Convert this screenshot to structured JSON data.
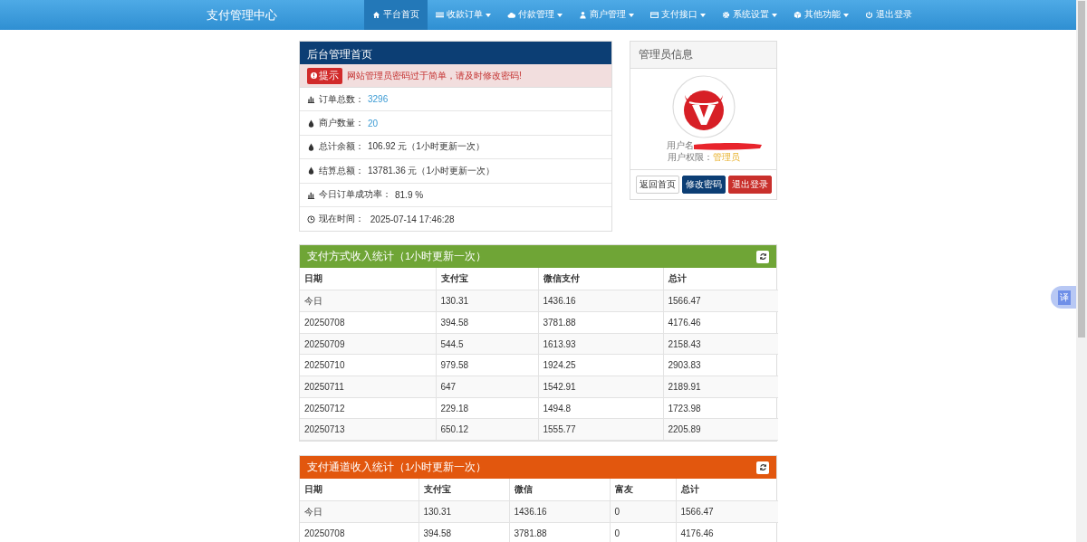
{
  "navbar": {
    "brand": "支付管理中心",
    "items": [
      {
        "label": "平台首页",
        "kind": "home",
        "dropdown": false,
        "selected": true
      },
      {
        "label": "收款订单",
        "kind": "list",
        "dropdown": true,
        "selected": false
      },
      {
        "label": "付款管理",
        "kind": "cloud",
        "dropdown": true,
        "selected": false
      },
      {
        "label": "商户管理",
        "kind": "user",
        "dropdown": true,
        "selected": false
      },
      {
        "label": "支付接口",
        "kind": "card",
        "dropdown": true,
        "selected": false
      },
      {
        "label": "系统设置",
        "kind": "gear",
        "dropdown": true,
        "selected": false
      },
      {
        "label": "其他功能",
        "kind": "cube",
        "dropdown": true,
        "selected": false
      },
      {
        "label": "退出登录",
        "kind": "power",
        "dropdown": false,
        "selected": false
      }
    ]
  },
  "overview": {
    "title": "后台管理首页",
    "alert": {
      "badge": "提示",
      "text": "网站管理员密码过于简单，请及时修改密码!"
    },
    "rows": [
      {
        "kind": "bars",
        "label": "订单总数：",
        "value": "3296",
        "accent": true
      },
      {
        "kind": "drop",
        "label": "商户数量：",
        "value": "20",
        "accent": true
      },
      {
        "kind": "drop",
        "label": "总计余额：",
        "value": "106.92 元（1小时更新一次）",
        "accent": false
      },
      {
        "kind": "drop",
        "label": "结算总额：",
        "value": "13781.36 元（1小时更新一次）",
        "accent": false
      },
      {
        "kind": "bars",
        "label": "今日订单成功率：",
        "value": "81.9 %",
        "accent": false
      },
      {
        "kind": "clock",
        "label": "现在时间：",
        "value": " 2025-07-14 17:46:28",
        "accent": false
      }
    ]
  },
  "admin": {
    "title": "管理员信息",
    "username_label": "用户名",
    "role_label": "用户权限：",
    "role": "管理员",
    "buttons": [
      {
        "label": "返回首页",
        "kind": "default"
      },
      {
        "label": "修改密码",
        "kind": "primary"
      },
      {
        "label": "退出登录",
        "kind": "danger"
      }
    ]
  },
  "tables": [
    {
      "title": "支付方式收入统计（1小时更新一次）",
      "color": "#6fa536",
      "columns": [
        "日期",
        "支付宝",
        "微信支付",
        "总计"
      ],
      "rows": [
        [
          "今日",
          "130.31",
          "1436.16",
          "1566.47"
        ],
        [
          "20250708",
          "394.58",
          "3781.88",
          "4176.46"
        ],
        [
          "20250709",
          "544.5",
          "1613.93",
          "2158.43"
        ],
        [
          "20250710",
          "979.58",
          "1924.25",
          "2903.83"
        ],
        [
          "20250711",
          "647",
          "1542.91",
          "2189.91"
        ],
        [
          "20250712",
          "229.18",
          "1494.8",
          "1723.98"
        ],
        [
          "20250713",
          "650.12",
          "1555.77",
          "2205.89"
        ]
      ]
    },
    {
      "title": "支付通道收入统计（1小时更新一次）",
      "color": "#e2570e",
      "columns": [
        "日期",
        "支付宝",
        "微信",
        "富友",
        "总计"
      ],
      "rows": [
        [
          "今日",
          "130.31",
          "1436.16",
          "0",
          "1566.47"
        ],
        [
          "20250708",
          "394.58",
          "3781.88",
          "0",
          "4176.46"
        ]
      ]
    }
  ],
  "translate_button": "译"
}
